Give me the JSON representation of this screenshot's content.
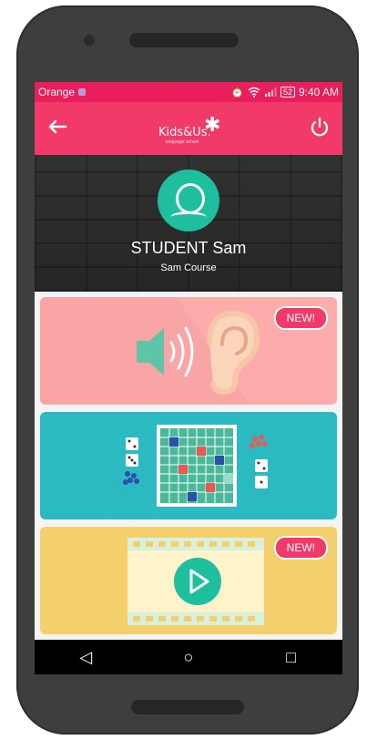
{
  "status_bar": {
    "carrier": "Orange",
    "time": "9:40 AM",
    "battery": "52"
  },
  "app_bar": {
    "logo_text": "Kids&Us.",
    "logo_subtext": "language school",
    "back_icon": "arrow-left-icon",
    "power_icon": "power-icon"
  },
  "profile": {
    "name": "STUDENT Sam",
    "course": "Sam Course"
  },
  "cards": [
    {
      "name": "listening-activity",
      "badge": "NEW!",
      "color": "#f9a5a5"
    },
    {
      "name": "board-game-activity",
      "badge": "",
      "color": "#2cbac2"
    },
    {
      "name": "video-activity",
      "badge": "NEW!",
      "color": "#f3d06c"
    }
  ],
  "nav": {
    "back": "◁",
    "home": "○",
    "recent": "□"
  },
  "colors": {
    "accent": "#f23a6a",
    "teal": "#1ebf9f"
  }
}
